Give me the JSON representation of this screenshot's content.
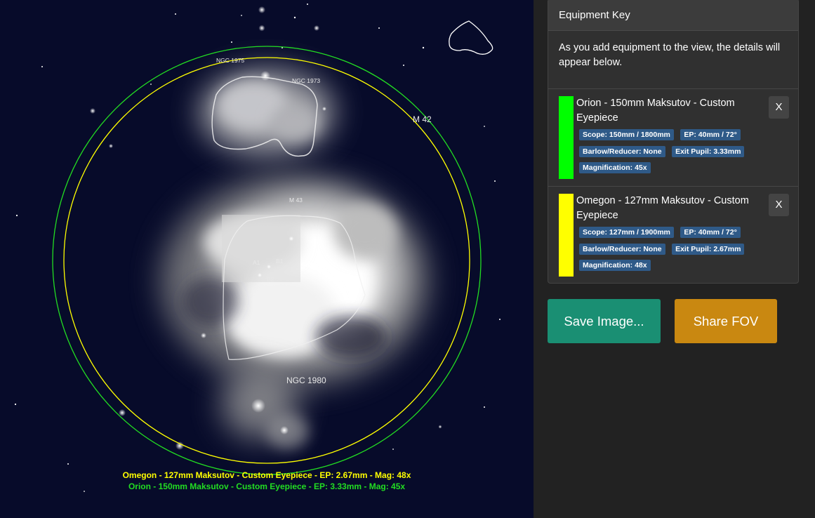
{
  "sky": {
    "object_labels": {
      "ngc1975": "NGC 1975",
      "ngc1973": "NGC 1973",
      "m42": "M 42",
      "m43": "M 43",
      "ngc1980": "NGC 1980",
      "star_b1": "B1",
      "star_b2": "B2",
      "star_a1": "A1"
    },
    "fov_labels": [
      {
        "text": "Omegon - 127mm Maksutov - Custom Eyepiece - EP: 2.67mm - Mag: 48x",
        "color": "#ffff00"
      },
      {
        "text": "Orion - 150mm Maksutov - Custom Eyepiece - EP: 3.33mm - Mag: 45x",
        "color": "#22dd22"
      }
    ]
  },
  "equipment_key": {
    "title": "Equipment Key",
    "intro": "As you add equipment to the view, the details will appear below.",
    "items": [
      {
        "color": "#00ff00",
        "title": "Orion - 150mm Maksutov - Custom Eyepiece",
        "remove_label": "X",
        "badges": [
          [
            "Scope: 150mm / 1800mm",
            "EP: 40mm / 72°"
          ],
          [
            "Barlow/Reducer: None",
            "Exit Pupil: 3.33mm"
          ],
          [
            "Magnification: 45x"
          ]
        ]
      },
      {
        "color": "#ffff00",
        "title": "Omegon - 127mm Maksutov - Custom Eyepiece",
        "remove_label": "X",
        "badges": [
          [
            "Scope: 127mm / 1900mm",
            "EP: 40mm / 72°"
          ],
          [
            "Barlow/Reducer: None",
            "Exit Pupil: 2.67mm"
          ],
          [
            "Magnification: 48x"
          ]
        ]
      }
    ]
  },
  "actions": {
    "save_label": "Save Image...",
    "share_label": "Share FOV"
  },
  "colors": {
    "save": "#1a8f73",
    "share": "#c98811",
    "badge": "#2f5a88",
    "sky": "#070b2a"
  }
}
